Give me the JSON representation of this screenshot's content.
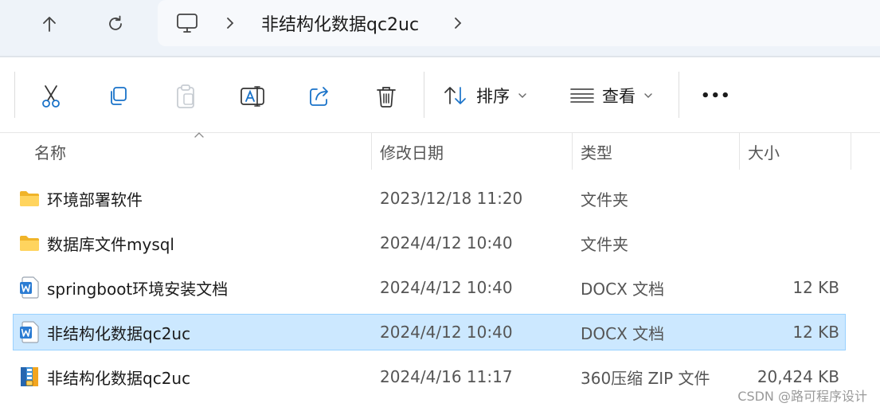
{
  "address": {
    "segments": [
      "非结构化数据qc2uc"
    ]
  },
  "nav": {
    "up_icon": "arrow-up-icon",
    "refresh_icon": "refresh-icon",
    "computer_icon": "computer-icon"
  },
  "toolbar": {
    "sort_label": "排序",
    "view_label": "查看",
    "more_label": "•••"
  },
  "columns": {
    "name": "名称",
    "date": "修改日期",
    "type": "类型",
    "size": "大小"
  },
  "files": [
    {
      "name": "环境部署软件",
      "date": "2023/12/18 11:20",
      "type": "文件夹",
      "size": "",
      "icon": "folder-icon",
      "selected": false
    },
    {
      "name": "数据库文件mysql",
      "date": "2024/4/12 10:40",
      "type": "文件夹",
      "size": "",
      "icon": "folder-icon",
      "selected": false
    },
    {
      "name": "springboot环境安装文档",
      "date": "2024/4/12 10:40",
      "type": "DOCX 文档",
      "size": "12 KB",
      "icon": "word-doc-icon",
      "selected": false
    },
    {
      "name": "非结构化数据qc2uc",
      "date": "2024/4/12 10:40",
      "type": "DOCX 文档",
      "size": "12 KB",
      "icon": "word-doc-icon",
      "selected": true
    },
    {
      "name": "非结构化数据qc2uc",
      "date": "2024/4/16 11:17",
      "type": "360压缩 ZIP 文件",
      "size": "20,424 KB",
      "icon": "zip-archive-icon",
      "selected": false
    }
  ],
  "watermark": "CSDN @路可程序设计",
  "colors": {
    "selection_bg": "#cce8ff",
    "selection_border": "#99d1ff",
    "folder": "#f4c542",
    "word_blue": "#2b7cd3"
  }
}
